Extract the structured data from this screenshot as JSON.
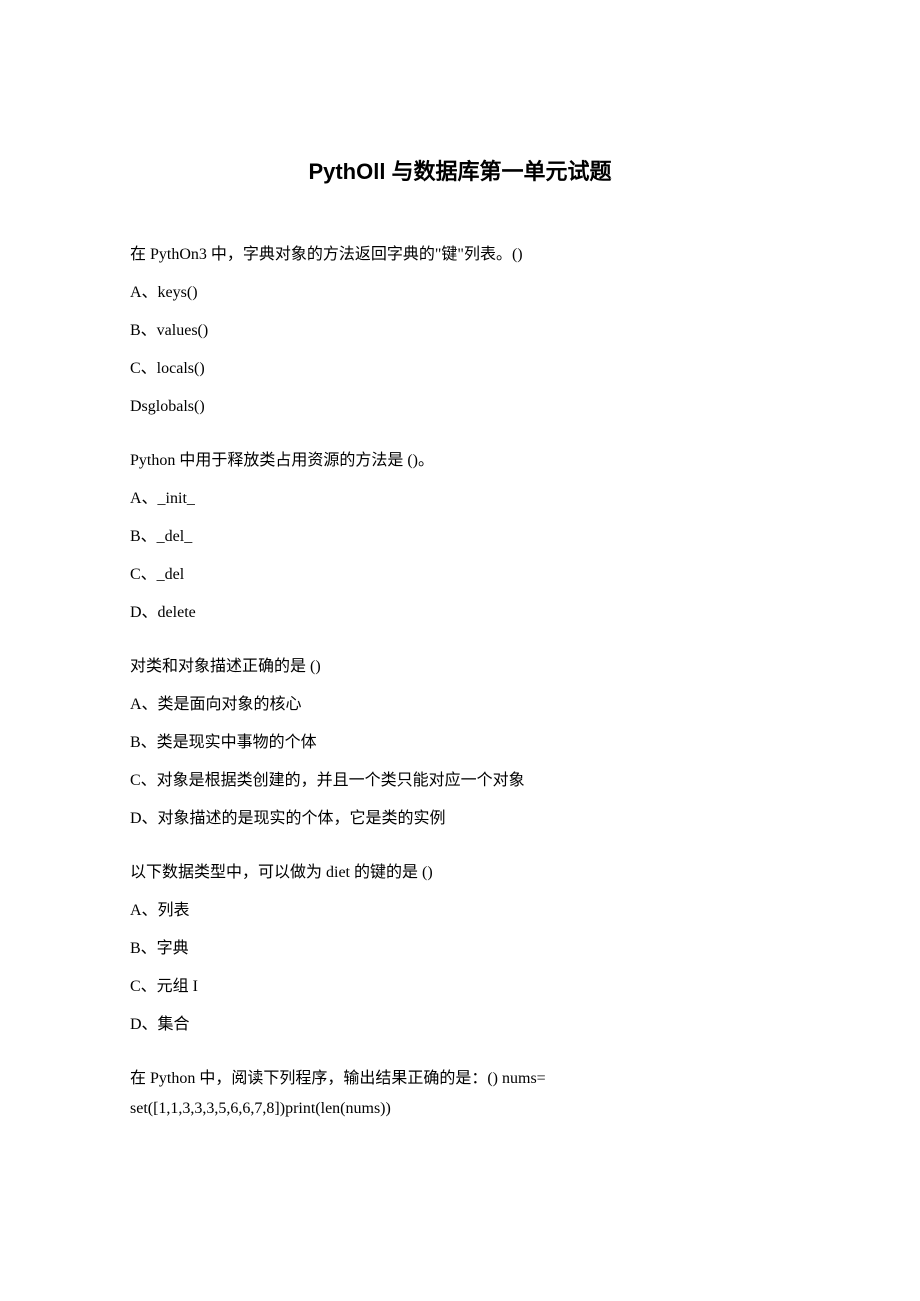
{
  "title": "PythOll 与数据库第一单元试题",
  "questions": [
    {
      "text": "在 PythOn3 中，字典对象的方法返回字典的\"键\"列表。()",
      "options": [
        "A、keys()",
        "B、values()",
        "C、locals()",
        "Dsglobals()"
      ]
    },
    {
      "text": "Python 中用于释放类占用资源的方法是 ()。",
      "options": [
        "A、_init_",
        "B、_del_",
        "C、_del",
        "D、delete"
      ]
    },
    {
      "text": "对类和对象描述正确的是 ()",
      "options": [
        "A、类是面向对象的核心",
        "B、类是现实中事物的个体",
        "C、对象是根据类创建的，并且一个类只能对应一个对象",
        "D、对象描述的是现实的个体，它是类的实例"
      ]
    },
    {
      "text": "以下数据类型中，可以做为 diet 的键的是 ()",
      "options": [
        "A、列表",
        "B、字典",
        "C、元组 I",
        "D、集合"
      ]
    },
    {
      "text": "在 Python 中，阅读下列程序，输出结果正确的是：() nums=",
      "line2": "set([1,1,3,3,3,5,6,6,7,8])print(len(nums))"
    }
  ]
}
